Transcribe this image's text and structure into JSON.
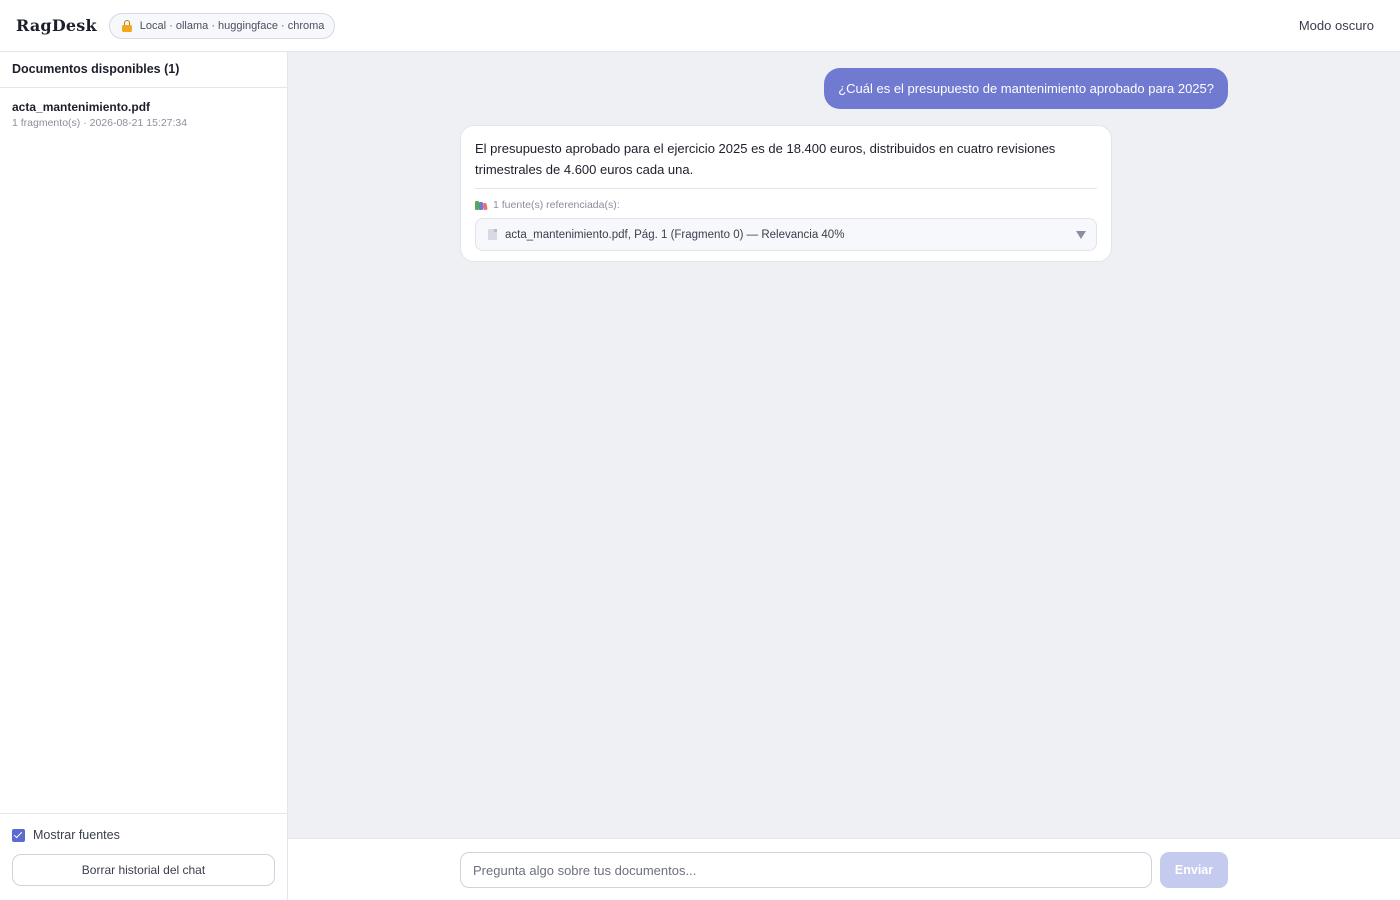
{
  "header": {
    "brand": "RagDesk",
    "status_pill": "Local · ollama · huggingface · chroma",
    "dark_mode_label": "Modo oscuro"
  },
  "sidebar": {
    "title": "Documentos disponibles (1)",
    "documents": [
      {
        "name": "acta_mantenimiento.pdf",
        "meta": "1 fragmento(s) · 2026-08-21 15:27:34"
      }
    ],
    "show_sources_label": "Mostrar fuentes",
    "show_sources_checked": true,
    "clear_button": "Borrar historial del chat"
  },
  "chat": {
    "user_message": "¿Cuál es el presupuesto de mantenimiento aprobado para 2025?",
    "assistant_message": "El presupuesto aprobado para el ejercicio 2025 es de 18.400 euros, distribuidos en cuatro revisiones trimestrales de 4.600 euros cada una.",
    "sources_label": "1 fuente(s) referenciada(s):",
    "sources": [
      {
        "label": "acta_mantenimiento.pdf, Pág. 1 (Fragmento 0) — Relevancia 40%"
      }
    ]
  },
  "composer": {
    "placeholder": "Pregunta algo sobre tus documentos...",
    "send_label": "Enviar"
  },
  "colors": {
    "accent": "#6f7ad0",
    "send_disabled": "#c5cbee",
    "main_bg": "#eef0f4"
  }
}
